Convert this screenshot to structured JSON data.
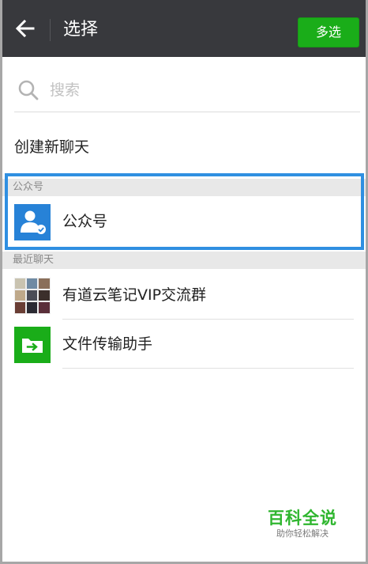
{
  "header": {
    "title": "选择",
    "multi_select_label": "多选"
  },
  "search": {
    "placeholder": "搜索"
  },
  "new_chat_label": "创建新聊天",
  "sections": [
    {
      "title": "公众号",
      "items": [
        {
          "label": "公众号",
          "icon": "official-account-icon"
        }
      ]
    },
    {
      "title": "最近聊天",
      "items": [
        {
          "label": "有道云笔记VIP交流群",
          "icon": "group-avatar-icon"
        },
        {
          "label": "文件传输助手",
          "icon": "file-transfer-icon"
        }
      ]
    }
  ],
  "watermark": {
    "title": "百科全说",
    "subtitle": "助你轻松解决"
  },
  "colors": {
    "titlebar": "#38393d",
    "accent_green": "#1aad19",
    "highlight_blue": "#2f8fe1",
    "official_account_blue": "#2782d7"
  }
}
